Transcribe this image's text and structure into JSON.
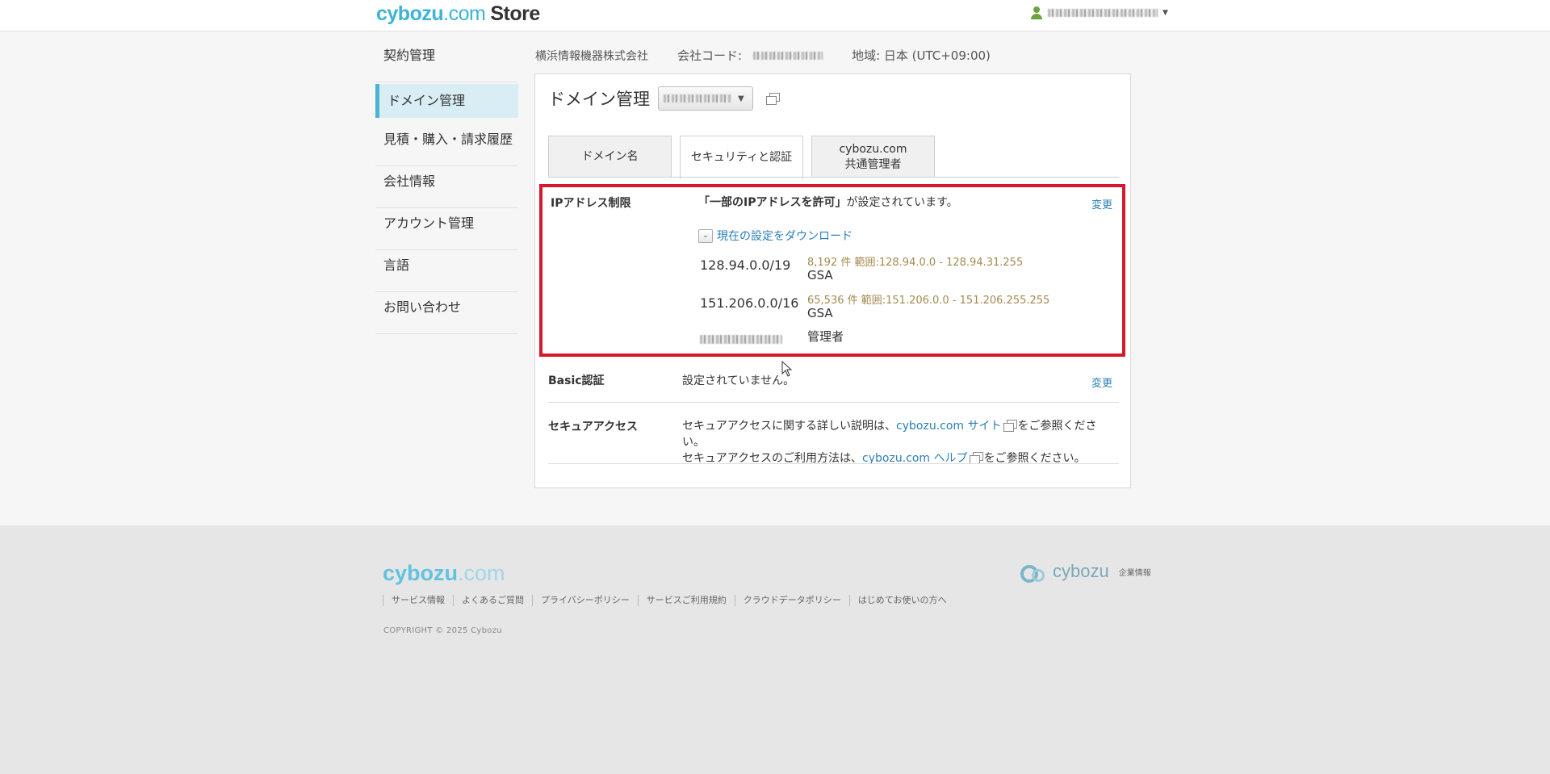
{
  "header": {
    "logo_brand": "cybozu",
    "logo_dot": ".com",
    "logo_store": "Store"
  },
  "sidebar": {
    "items": [
      {
        "label": "契約管理"
      },
      {
        "label": "ドメイン管理"
      },
      {
        "label": "見積・購入・請求履歴"
      },
      {
        "label": "会社情報"
      },
      {
        "label": "アカウント管理"
      },
      {
        "label": "言語"
      },
      {
        "label": "お問い合わせ"
      }
    ],
    "active_index": 1
  },
  "info": {
    "company": "横浜情報機器株式会社",
    "code_label": "会社コード:",
    "region": "地域: 日本 (UTC+09:00)"
  },
  "panel": {
    "title": "ドメイン管理",
    "tabs": [
      {
        "label": "ドメイン名"
      },
      {
        "label": "セキュリティと認証"
      },
      {
        "label_line1": "cybozu.com",
        "label_line2": "共通管理者"
      }
    ],
    "active_tab": 1
  },
  "ip_restriction": {
    "label": "IPアドレス制限",
    "status_bold": "「一部のIPアドレスを許可」",
    "status_rest": "が設定されています。",
    "change": "変更",
    "download": "現在の設定をダウンロード",
    "entries": [
      {
        "ip": "128.94.0.0/19",
        "meta": "8,192 件 範囲:128.94.0.0 - 128.94.31.255",
        "desc": "GSA"
      },
      {
        "ip": "151.206.0.0/16",
        "meta": "65,536 件 範囲:151.206.0.0 - 151.206.255.255",
        "desc": "GSA"
      },
      {
        "ip": "",
        "meta": "",
        "desc": "管理者"
      }
    ]
  },
  "basic_auth": {
    "label": "Basic認証",
    "status": "設定されていません。",
    "change": "変更"
  },
  "secure_access": {
    "label": "セキュアアクセス",
    "line1_pre": "セキュアアクセスに関する詳しい説明は、",
    "line1_link": "cybozu.com サイト",
    "line1_post": "をご参照ください。",
    "line2_pre": "セキュアアクセスのご利用方法は、",
    "line2_link": "cybozu.com ヘルプ",
    "line2_post": "をご参照ください。"
  },
  "footer": {
    "logo_brand": "cybozu",
    "logo_dot": ".com",
    "links": [
      "サービス情報",
      "よくあるご質問",
      "プライバシーポリシー",
      "サービスご利用規約",
      "クラウドデータポリシー",
      "はじめてお使いの方へ"
    ],
    "copyright": "COPYRIGHT © 2025 Cybozu",
    "corp_name": "cybozu",
    "corp_info": "企業情報"
  },
  "colors": {
    "accent": "#3bb4d8",
    "link": "#2b7fb8",
    "highlight_box": "#d5182b",
    "meta_text": "#a38a4f"
  }
}
